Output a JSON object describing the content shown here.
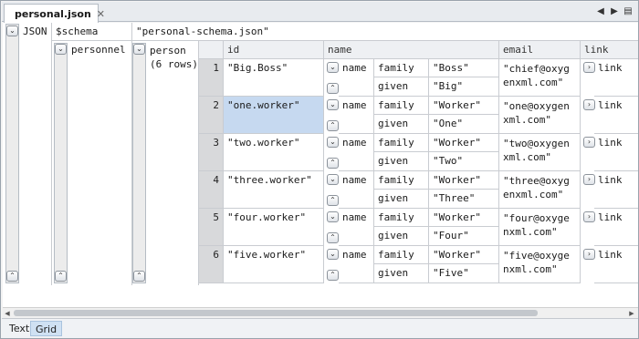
{
  "tab": {
    "title": "personal.json",
    "close": "✕"
  },
  "nav": {
    "prev": "◀",
    "next": "▶",
    "menu": "▤"
  },
  "json_label": "JSON",
  "schema": {
    "key": "$schema",
    "value": "\"personal-schema.json\""
  },
  "personnel": {
    "key": "personnel"
  },
  "person": {
    "key": "person",
    "count": "(6 rows)"
  },
  "columns": {
    "id": "id",
    "name": "name",
    "email": "email",
    "link": "link"
  },
  "sub": {
    "name": "name",
    "family": "family",
    "given": "given",
    "link": "link"
  },
  "rows": [
    {
      "num": "1",
      "id": "\"Big.Boss\"",
      "family": "\"Boss\"",
      "given": "\"Big\"",
      "email1": "\"chief@oxyg",
      "email2": "enxml.com\""
    },
    {
      "num": "2",
      "id": "\"one.worker\"",
      "family": "\"Worker\"",
      "given": "\"One\"",
      "email1": "\"one@oxygen",
      "email2": "xml.com\""
    },
    {
      "num": "3",
      "id": "\"two.worker\"",
      "family": "\"Worker\"",
      "given": "\"Two\"",
      "email1": "\"two@oxygen",
      "email2": "xml.com\""
    },
    {
      "num": "4",
      "id": "\"three.worker\"",
      "family": "\"Worker\"",
      "given": "\"Three\"",
      "email1": "\"three@oxyg",
      "email2": "enxml.com\""
    },
    {
      "num": "5",
      "id": "\"four.worker\"",
      "family": "\"Worker\"",
      "given": "\"Four\"",
      "email1": "\"four@oxyge",
      "email2": "nxml.com\""
    },
    {
      "num": "6",
      "id": "\"five.worker\"",
      "family": "\"Worker\"",
      "given": "\"Five\"",
      "email1": "\"five@oxyge",
      "email2": "nxml.com\""
    }
  ],
  "icons": {
    "collapse": "⌄",
    "expand": "⌃",
    "more": "›"
  },
  "bottom_tabs": {
    "text": "Text",
    "grid": "Grid"
  },
  "colors": {
    "selected_cell": "#c6d9f0",
    "row_number_bg": "#d8d9db"
  }
}
